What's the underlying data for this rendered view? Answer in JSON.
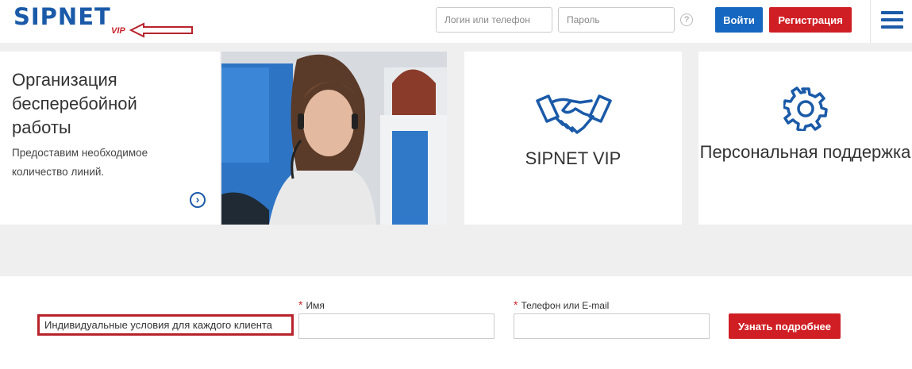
{
  "header": {
    "logo": "SIPNET",
    "logo_sub": "VIP",
    "login_placeholder": "Логин или телефон",
    "password_placeholder": "Пароль",
    "help": "?",
    "login_button": "Войти",
    "register_button": "Регистрация",
    "colors": {
      "brand": "#1a5aa8",
      "accent": "#d01f24"
    }
  },
  "cards": {
    "feature": {
      "title": "Организация бесперебойной работы",
      "text": "Предоставим необходимое количество линий.",
      "more_icon": "chevron-right-circle-icon"
    },
    "vip": {
      "label": "SIPNET VIP",
      "icon": "handshake-icon"
    },
    "support": {
      "label": "Персональная поддержка",
      "icon": "gear-icon"
    }
  },
  "form": {
    "tagline": "Индивидуальные условия для каждого клиента",
    "name_label": "Имя",
    "contact_label": "Телефон или E-mail",
    "required_mark": "*",
    "submit_button": "Узнать подробнее"
  }
}
